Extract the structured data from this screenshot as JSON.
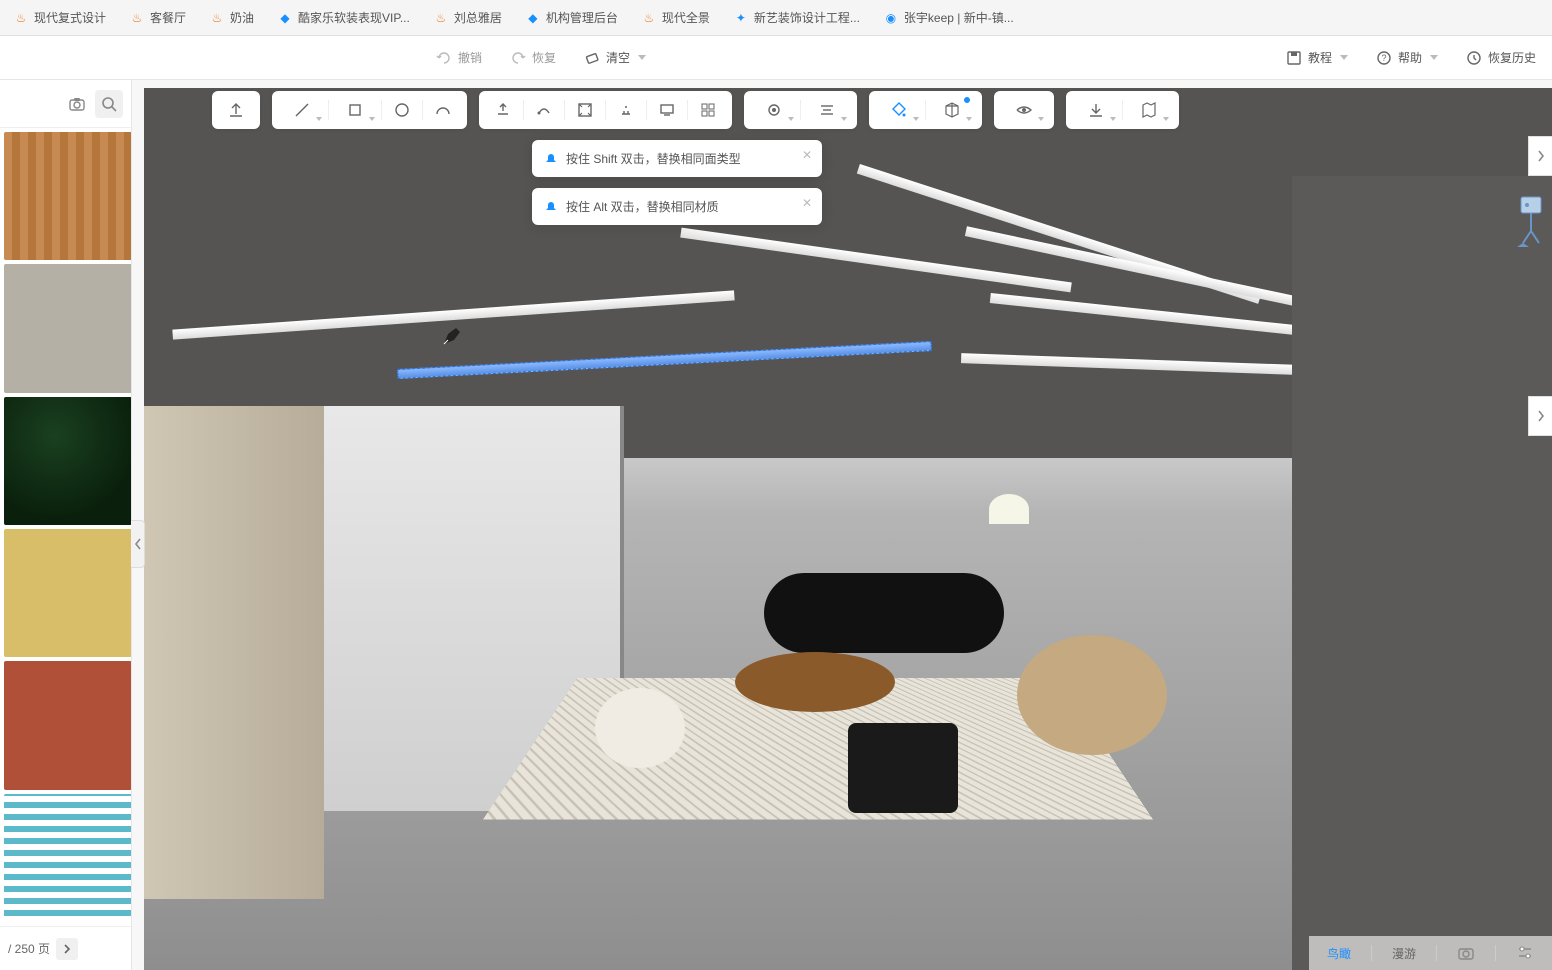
{
  "tabs": [
    {
      "label": "现代复式设计",
      "icon": "fire"
    },
    {
      "label": "客餐厅",
      "icon": "fire"
    },
    {
      "label": "奶油",
      "icon": "fire"
    },
    {
      "label": "酷家乐软装表现VIP...",
      "icon": "diamond"
    },
    {
      "label": "刘总雅居",
      "icon": "fire"
    },
    {
      "label": "机构管理后台",
      "icon": "diamond"
    },
    {
      "label": "现代全景",
      "icon": "fire"
    },
    {
      "label": "新艺装饰设计工程...",
      "icon": "light"
    },
    {
      "label": "张宇keep | 新中-镇...",
      "icon": "circle"
    }
  ],
  "toolbar": {
    "undo": "撤销",
    "redo": "恢复",
    "clear": "清空",
    "tutorial": "教程",
    "help": "帮助",
    "history": "恢复历史"
  },
  "tips": {
    "shift": "按住 Shift 双击，替换相同面类型",
    "alt": "按住 Alt 双击，替换相同材质"
  },
  "pager": {
    "total": "/ 250 页"
  },
  "bottom": {
    "birdview": "鸟瞰",
    "roam": "漫游"
  },
  "search": {
    "placeholder": ""
  }
}
